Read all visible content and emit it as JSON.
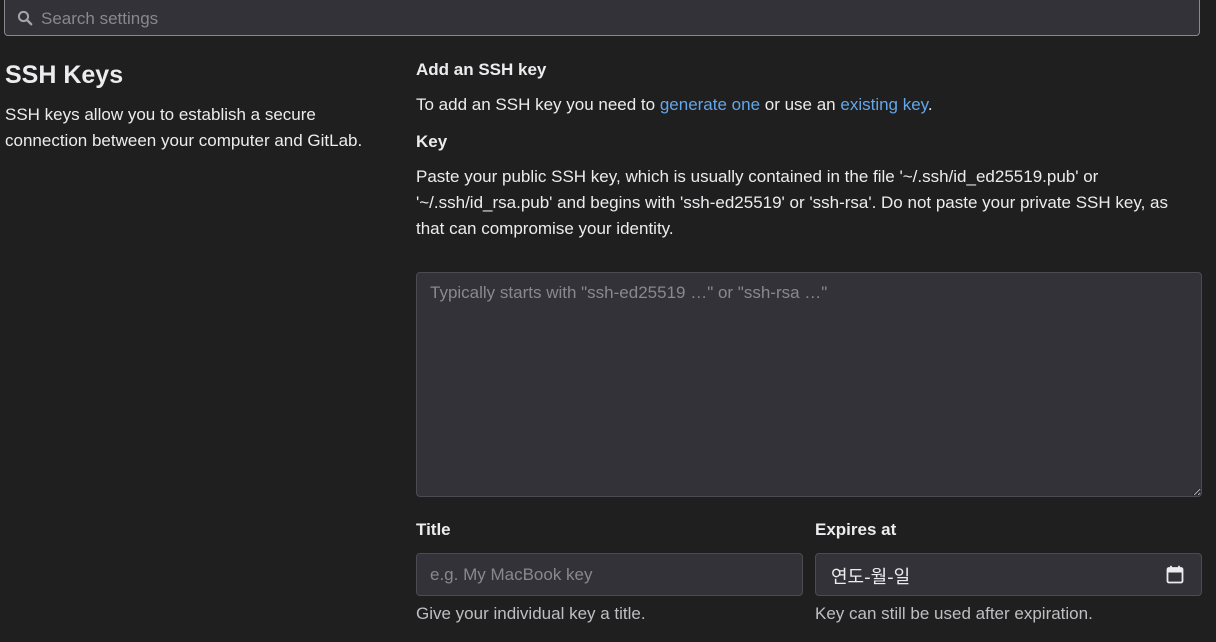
{
  "search": {
    "placeholder": "Search settings",
    "icon": "search-icon"
  },
  "section": {
    "title": "SSH Keys",
    "description": "SSH keys allow you to establish a secure connection between your computer and GitLab."
  },
  "add_key": {
    "heading": "Add an SSH key",
    "intro_prefix": "To add an SSH key you need to ",
    "link_generate": "generate one",
    "intro_middle": " or use an ",
    "link_existing": "existing key",
    "intro_suffix": "."
  },
  "key_field": {
    "label": "Key",
    "help": "Paste your public SSH key, which is usually contained in the file '~/.ssh/id_ed25519.pub' or '~/.ssh/id_rsa.pub' and begins with 'ssh-ed25519' or 'ssh-rsa'. Do not paste your private SSH key, as that can compromise your identity.",
    "placeholder": "Typically starts with \"ssh-ed25519 …\" or \"ssh-rsa …\""
  },
  "title_field": {
    "label": "Title",
    "placeholder": "e.g. My MacBook key",
    "help": "Give your individual key a title."
  },
  "expires_field": {
    "label": "Expires at",
    "value": "연도-월-일",
    "icon": "calendar-icon",
    "help": "Key can still be used after expiration."
  },
  "colors": {
    "background": "#1f1f1f",
    "input_background": "#333238",
    "link": "#63a6e9",
    "text": "#ececef"
  }
}
